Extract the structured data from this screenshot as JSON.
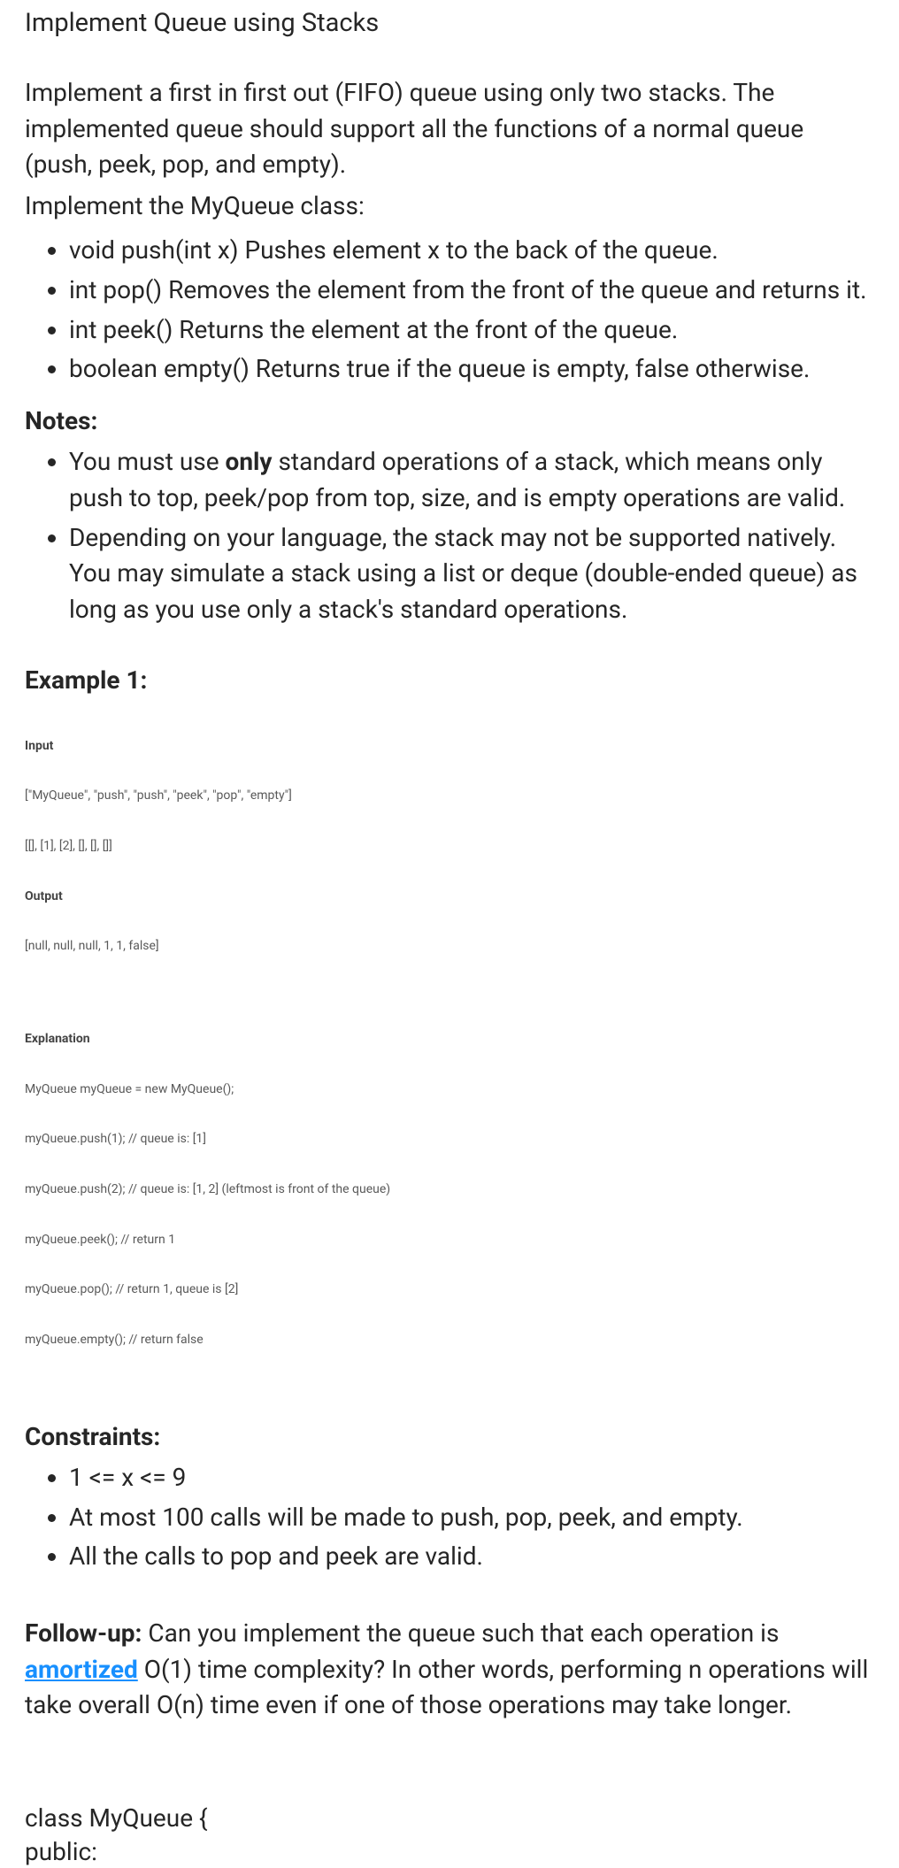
{
  "title": "Implement Queue using Stacks",
  "intro": {
    "p1": "Implement a first in first out (FIFO) queue using only two stacks. The implemented queue should support all the functions of a normal queue (push, peek, pop, and empty).",
    "p2": "Implement the MyQueue class:"
  },
  "methods": [
    "void push(int x) Pushes element x to the back of the queue.",
    "int pop() Removes the element from the front of the queue and returns it.",
    "int peek() Returns the element at the front of the queue.",
    "boolean empty() Returns true if the queue is empty, false otherwise."
  ],
  "notes_heading": "Notes:",
  "notes": {
    "n1_pre": "You must use ",
    "n1_strong": "only",
    "n1_post": " standard operations of a stack, which means only push to top, peek/pop from top, size, and is empty operations are valid.",
    "n2": "Depending on your language, the stack may not be supported natively. You may simulate a stack using a list or deque (double-ended queue) as long as you use only a stack's standard operations."
  },
  "example_heading": "Example 1:",
  "example": {
    "input_label": "Input",
    "input_line1": "[\"MyQueue\", \"push\", \"push\", \"peek\", \"pop\", \"empty\"]",
    "input_line2": "[[], [1], [2], [], [], []]",
    "output_label": "Output",
    "output_line": "[null, null, null, 1, 1, false]",
    "explanation_label": "Explanation",
    "explanation_lines": [
      "MyQueue myQueue = new MyQueue();",
      "myQueue.push(1); // queue is: [1]",
      "myQueue.push(2); // queue is: [1, 2] (leftmost is front of the queue)",
      "myQueue.peek(); // return 1",
      "myQueue.pop(); // return 1, queue is [2]",
      "myQueue.empty(); // return false"
    ]
  },
  "constraints_heading": "Constraints:",
  "constraints": [
    "1 <= x <= 9",
    "At most 100 calls will be made to push, pop, peek, and empty.",
    "All the calls to pop and peek are valid."
  ],
  "followup": {
    "label": "Follow-up:",
    "pre": " Can you implement the queue such that each operation is ",
    "link": "amortized",
    "post": " O(1) time complexity? In other words, performing n operations will take overall O(n) time even if one of those operations may take longer."
  },
  "code": {
    "line1": "class MyQueue {",
    "line2": "public:"
  }
}
